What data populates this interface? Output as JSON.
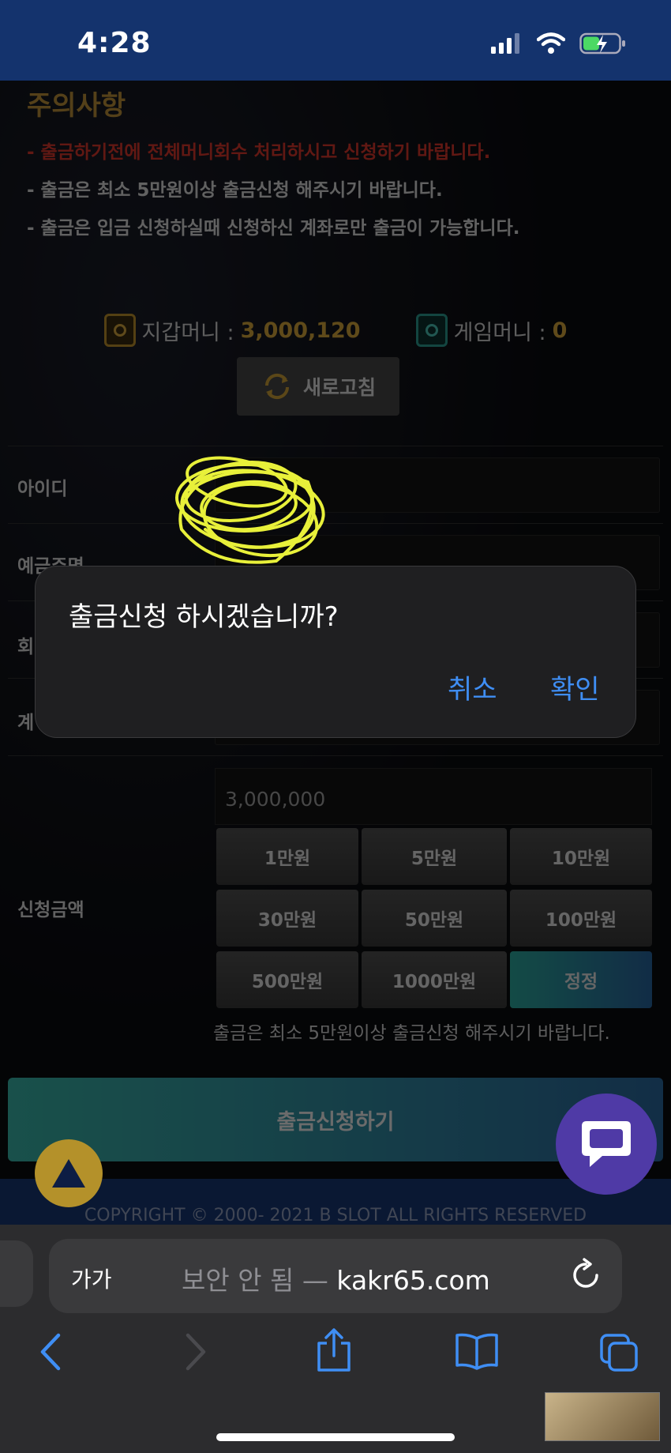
{
  "status_bar": {
    "time": "4:28",
    "battery_level": 0.4
  },
  "notice": {
    "title": "주의사항",
    "lines": [
      "- 출금하기전에 전체머니회수 처리하시고 신청하기 바랍니다.",
      "- 출금은 최소 5만원이상 출금신청 해주시기 바랍니다.",
      "- 출금은 입금 신청하실때 신청하신 계좌로만 출금이 가능합니다."
    ]
  },
  "balance": {
    "wallet_label": "지갑머니 :",
    "wallet_value": "3,000,120",
    "game_label": "게임머니 :",
    "game_value": "0",
    "refresh_label": "새로고침"
  },
  "form": {
    "id_label": "아이디",
    "holder_label": "예금주명",
    "row3_label": "회",
    "row4_label": "계",
    "amount_label": "신청금액",
    "amount_value": "3,000,000",
    "amount_buttons": [
      "1만원",
      "5만원",
      "10만원",
      "30만원",
      "50만원",
      "100만원",
      "500만원",
      "1000만원",
      "정정"
    ],
    "amount_note": "출금은 최소 5만원이상 출금신청 해주시기 바랍니다.",
    "submit_label": "출금신청하기"
  },
  "footer": {
    "text": "COPYRIGHT © 2000- 2021 B SLOT ALL RIGHTS RESERVED"
  },
  "dialog": {
    "message": "출금신청 하시겠습니까?",
    "cancel": "취소",
    "confirm": "확인"
  },
  "browser": {
    "aa_label": "가가",
    "security_label": "보안 안 됨 —",
    "domain": "kakr65.com"
  },
  "colors": {
    "accent_gold": "#c89a3c",
    "warning_red": "#e63a2e",
    "link_blue": "#3f8ef4",
    "header_blue": "#14336d"
  }
}
